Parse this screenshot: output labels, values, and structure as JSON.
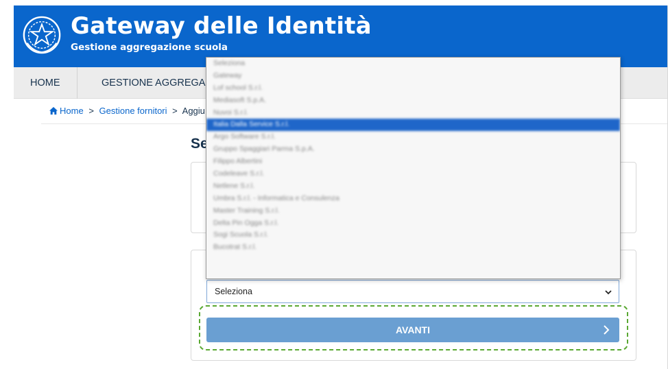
{
  "header": {
    "title": "Gateway delle Identità",
    "subtitle": "Gestione aggregazione scuola",
    "brand_color": "#0a66cc",
    "emblem_icon": "italian-republic-emblem-icon"
  },
  "nav": {
    "items": [
      {
        "label": "HOME"
      },
      {
        "label": "GESTIONE AGGREGAZIO"
      }
    ]
  },
  "breadcrumb": {
    "home": "Home",
    "separator": ">",
    "item2": "Gestione fornitori",
    "item3": "Aggiu"
  },
  "page": {
    "heading": "Se"
  },
  "select": {
    "value": "Seleziona",
    "caret_icon": "chevron-down-icon"
  },
  "dropdown": {
    "selected_index": 5,
    "selected_color": "#1f66c9",
    "options": [
      "Seleziona",
      "Gateway",
      "Lof school S.r.l.",
      "Mediasoft S.p.A.",
      "Nuvoi S.r.l.",
      "Italia Dalla Service S.r.l.",
      "Argo Software S.r.l.",
      "Gruppo Spaggiari Parma S.p.A.",
      "Filippo Albertini",
      "Codeleave S.r.l.",
      "Netlene S.r.l.",
      "Umbra S.r.l. - Informatica e Consulenza",
      "Master Training S.r.l.",
      "Delta Pin Ogga S.r.l.",
      "Sogi Scuola S.r.l.",
      "Bucotrat S.r.l."
    ]
  },
  "actions": {
    "next_label": "AVANTI",
    "next_icon": "chevron-right-icon",
    "next_color": "#6a9fd2",
    "highlight_color": "#5aa832"
  }
}
